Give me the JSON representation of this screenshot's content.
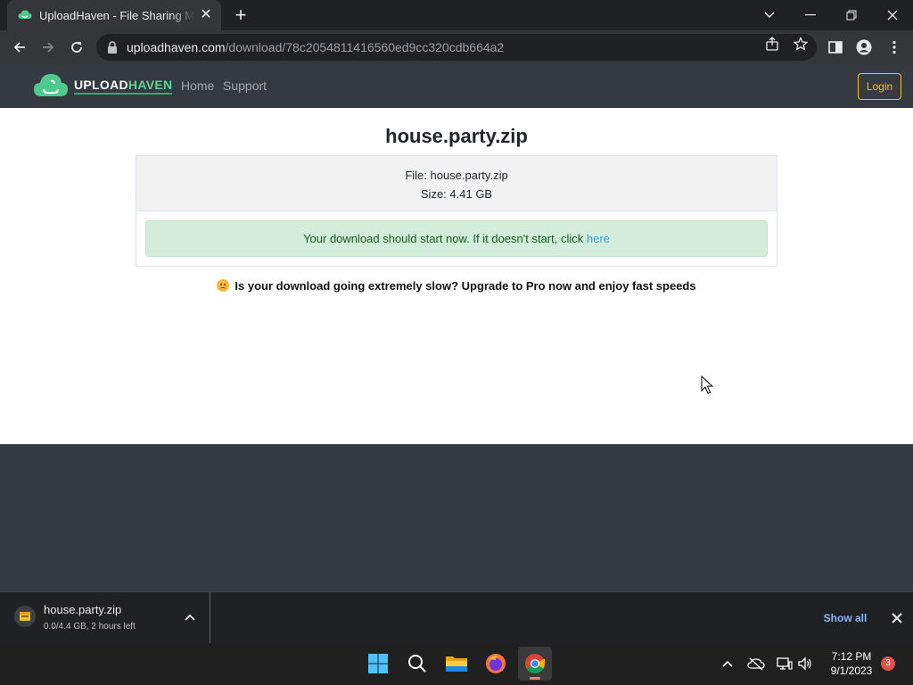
{
  "browser": {
    "tab_title": "UploadHaven - File Sharing Made Easy",
    "url_host": "uploadhaven.com",
    "url_path": "/download/78c2054811416560ed9cc320cdb664a2"
  },
  "site": {
    "logo_part1": "UPLOAD",
    "logo_part2": "HAVEN",
    "nav": {
      "home": "Home",
      "support": "Support",
      "login": "Login"
    },
    "file_heading": "house.party.zip",
    "file_line": "File: house.party.zip",
    "size_line": "Size: 4.41 GB",
    "alert_text": "Your download should start now. If it doesn't start, click ",
    "alert_link": "here",
    "slow_message": "Is your download going extremely slow? Upgrade to Pro now and enjoy fast speeds"
  },
  "download_shelf": {
    "file_name": "house.party.zip",
    "status": "0.0/4.4 GB, 2 hours left",
    "show_all": "Show all"
  },
  "taskbar": {
    "time": "7:12 PM",
    "date": "9/1/2023",
    "notification_count": "3"
  },
  "colors": {
    "site_nav_bg": "#343a40",
    "alert_bg": "#d4edda",
    "login_accent": "#ffc107",
    "brand_green": "#5fd39a"
  }
}
